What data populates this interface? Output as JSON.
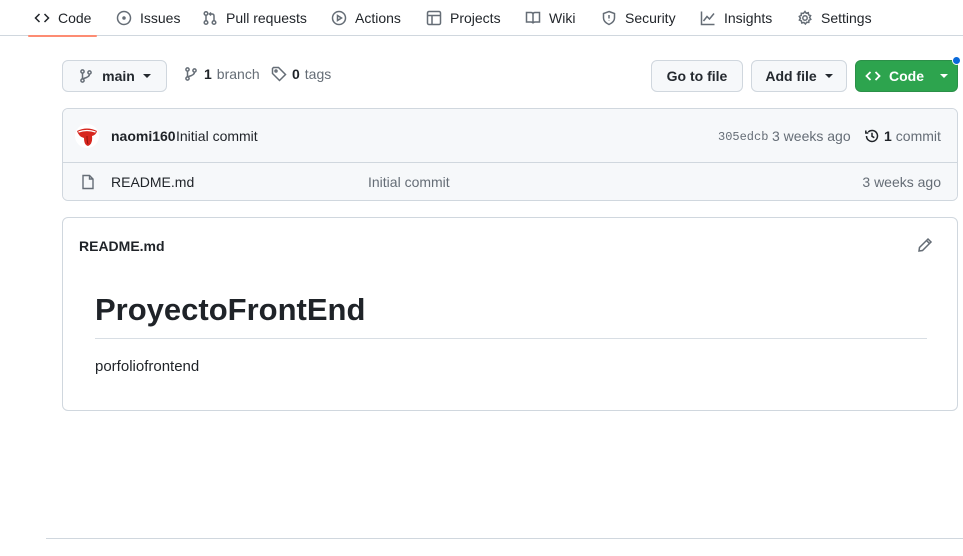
{
  "nav": {
    "tabs": [
      {
        "label": "Code",
        "icon": "code-icon",
        "selected": true
      },
      {
        "label": "Issues",
        "icon": "issue-icon"
      },
      {
        "label": "Pull requests",
        "icon": "pull-request-icon"
      },
      {
        "label": "Actions",
        "icon": "play-icon"
      },
      {
        "label": "Projects",
        "icon": "table-icon"
      },
      {
        "label": "Wiki",
        "icon": "book-icon"
      },
      {
        "label": "Security",
        "icon": "shield-icon"
      },
      {
        "label": "Insights",
        "icon": "graph-icon"
      },
      {
        "label": "Settings",
        "icon": "gear-icon"
      }
    ],
    "selected_underline_color": "#fd8c73"
  },
  "toolbar": {
    "branch_label": "main",
    "branch_count": "1",
    "branch_word": "branch",
    "tag_count": "0",
    "tag_word": "tags",
    "go_to_file": "Go to file",
    "add_file": "Add file",
    "code_button": "Code",
    "code_button_color": "#2da44e"
  },
  "latest_commit": {
    "author": "naomi160",
    "message": "Initial commit",
    "sha": "305edcb",
    "time": "3 weeks ago",
    "commit_count": "1",
    "commit_word": "commit"
  },
  "files": [
    {
      "name": "README.md",
      "icon": "file-icon",
      "commit_message": "Initial commit",
      "age": "3 weeks ago"
    }
  ],
  "readme": {
    "filename": "README.md",
    "heading": "ProyectoFrontEnd",
    "body": "porfoliofrontend"
  }
}
